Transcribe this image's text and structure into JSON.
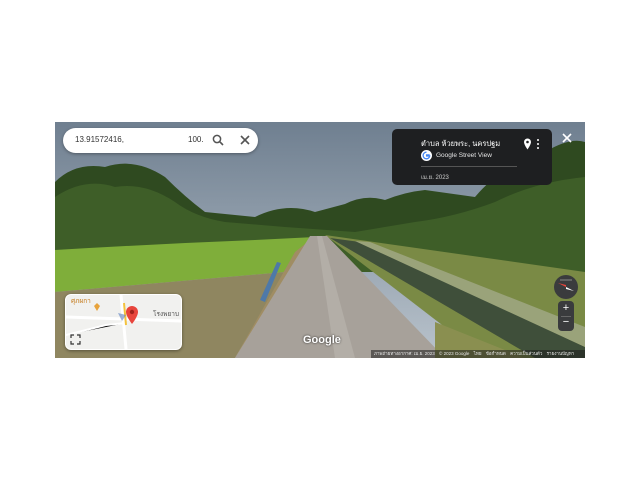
{
  "search": {
    "coord_lat": "13.91572416,",
    "coord_lng": "100."
  },
  "info_card": {
    "title": "ตำบล ห้วยพระ, นครปฐม",
    "source": "Google Street View",
    "date": "เม.ย. 2023"
  },
  "minimap": {
    "place_label": "ศุภผกา",
    "place_label_2": "โรงพยาบ"
  },
  "logo": "Google",
  "footer": {
    "imagery": "ภาพถ่ายทางอากาศ: เม.ย. 2023",
    "copyright": "© 2023 Google",
    "link1": "ไทย",
    "link2": "ข้อกำหนด",
    "link3": "ความเป็นส่วนตัว",
    "link4": "รายงานปัญหา"
  },
  "icons": {
    "search": "search-icon",
    "clear": "close-icon",
    "close_viewer": "close-icon",
    "pin": "location-pin-icon",
    "more": "more-vert-icon",
    "expand": "expand-icon",
    "compass": "compass-icon"
  },
  "colors": {
    "card_bg": "#1e1f21",
    "pin_red": "#e8453c",
    "sky": "#8fa3b5",
    "grass": "#6e9a3a"
  }
}
